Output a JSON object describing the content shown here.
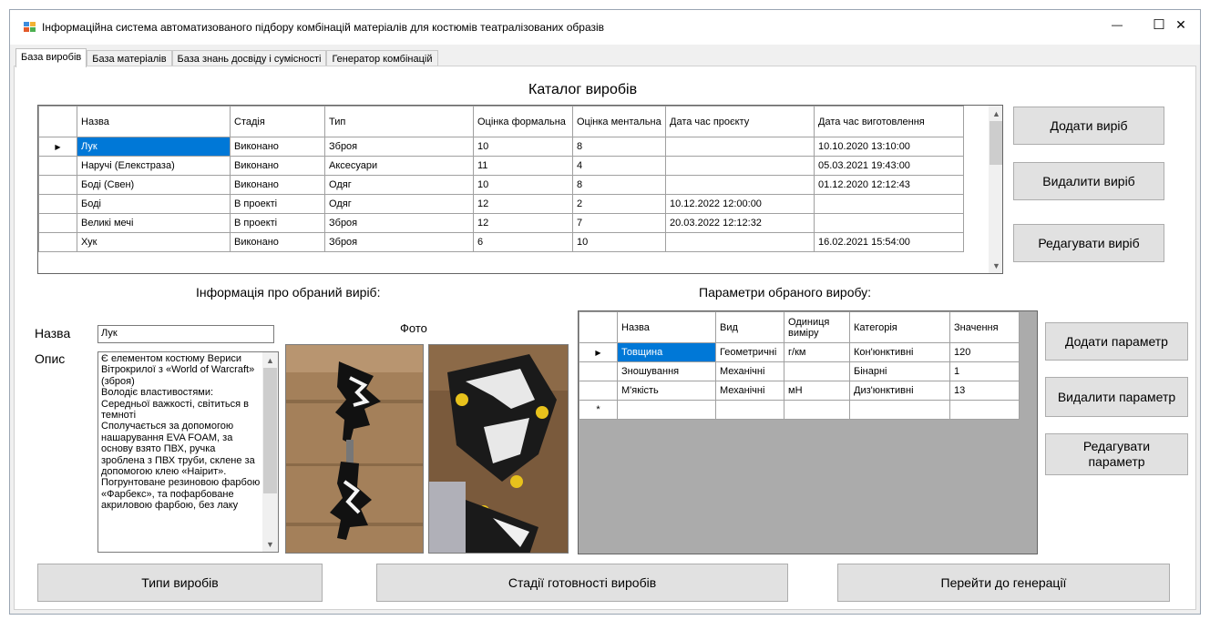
{
  "window": {
    "title": "Інформаційна система автоматизованого підбору комбінацій матеріалів для костюмів театралізованих образів",
    "minimize_glyph": "—",
    "maximize_glyph": "☐",
    "close_glyph": "✕"
  },
  "tabs": [
    "База виробів",
    "База матеріалів",
    "База знань досвіду і сумісності",
    "Генератор комбінацій"
  ],
  "catalog": {
    "title": "Каталог виробів",
    "columns": [
      "Назва",
      "Стадія",
      "Тип",
      "Оцінка формальна",
      "Оцінка ментальна",
      "Дата час проєкту",
      "Дата час виготовлення"
    ],
    "rows": [
      [
        "Лук",
        "Виконано",
        "Зброя",
        "10",
        "8",
        "",
        "10.10.2020 13:10:00"
      ],
      [
        "Наручі (Елекстраза)",
        "Виконано",
        "Аксесуари",
        "11",
        "4",
        "",
        "05.03.2021 19:43:00"
      ],
      [
        "Боді (Свен)",
        "Виконано",
        "Одяг",
        "10",
        "8",
        "",
        "01.12.2020 12:12:43"
      ],
      [
        "Боді",
        "В проекті",
        "Одяг",
        "12",
        "2",
        "10.12.2022 12:00:00",
        ""
      ],
      [
        "Великі мечі",
        "В проекті",
        "Зброя",
        "12",
        "7",
        "20.03.2022 12:12:32",
        ""
      ],
      [
        "Хук",
        "Виконано",
        "Зброя",
        "6",
        "10",
        "",
        "16.02.2021 15:54:00"
      ]
    ]
  },
  "product_buttons": {
    "add": "Додати виріб",
    "delete": "Видалити виріб",
    "edit": "Редагувати виріб"
  },
  "info": {
    "title": "Інформація про обраний виріб:",
    "name_label": "Назва",
    "name_value": "Лук",
    "desc_label": "Опис",
    "photo_label": "Фото",
    "description": "Є елементом костюму Вериси Вітрокрилої з «World of Warcraft» (зброя)\nВолодіє властивостями: Середньої важкості, світиться в темноті\nСполучається за допомогою нашарування EVA FOAM, за основу взято ПВХ, ручка зроблена з ПВХ труби, склене за допомогою клею «Наірит». Погрунтоване резиновою фарбою «Фарбекс», та пофарбоване акриловою фарбою, без лаку"
  },
  "params": {
    "title": "Параметри обраного виробу:",
    "columns": [
      "Назва",
      "Вид",
      "Одиниця виміру",
      "Категорія",
      "Значення"
    ],
    "rows": [
      [
        "Товщина",
        "Геометричні",
        "г/км",
        "Кон'юнктивні",
        "120"
      ],
      [
        "Зношування",
        "Механічні",
        "",
        "Бінарні",
        "1"
      ],
      [
        "М'якість",
        "Механічні",
        "мН",
        "Диз'юнктивні",
        "13"
      ]
    ],
    "new_row_marker": "*"
  },
  "param_buttons": {
    "add": "Додати параметр",
    "delete": "Видалити параметр",
    "edit": "Редагувати параметр"
  },
  "bottom_buttons": {
    "types": "Типи виробів",
    "stages": "Стадії готовності виробів",
    "generate": "Перейти до генерації"
  }
}
